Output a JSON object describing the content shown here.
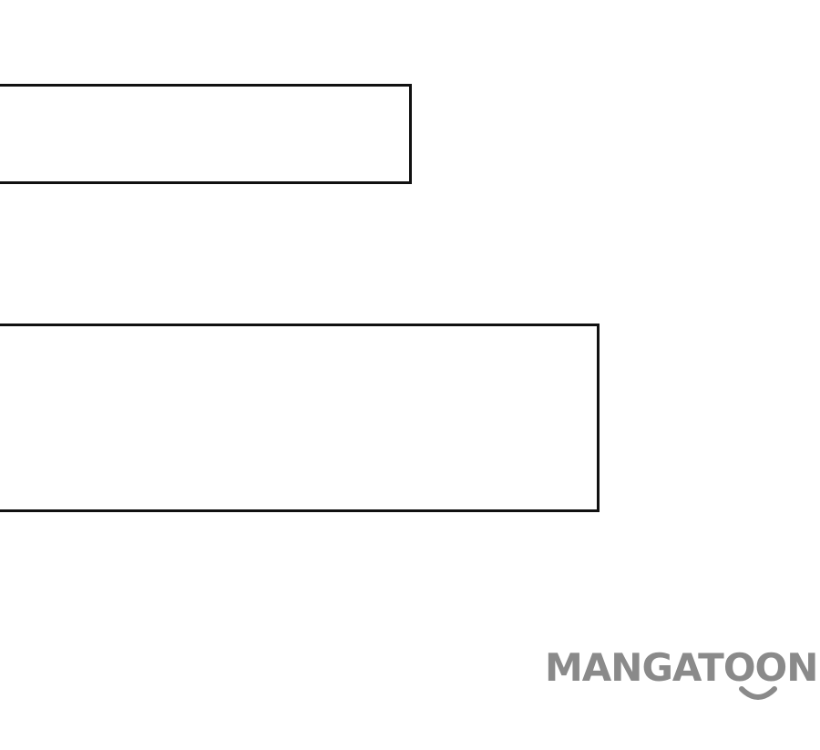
{
  "watermark": {
    "text": "MANGATOON",
    "color": "#8a8a8a"
  },
  "colors": {
    "background": "#ffffff",
    "panel_border": "#111111"
  },
  "icons": {
    "watermark_smile": "smile-arc-icon"
  }
}
